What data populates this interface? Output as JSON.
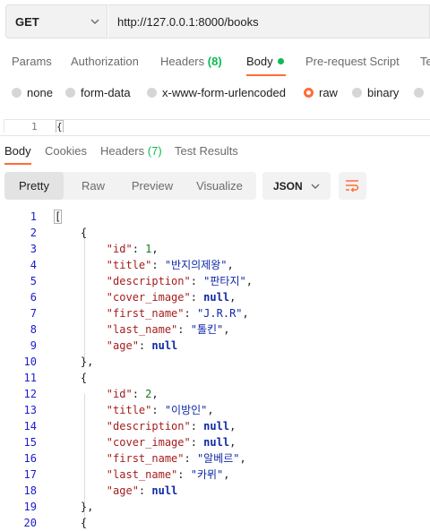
{
  "request": {
    "method": "GET",
    "url": "http://127.0.0.1:8000/books"
  },
  "request_tabs": [
    {
      "label": "Params"
    },
    {
      "label": "Authorization"
    },
    {
      "label": "Headers",
      "count": "(8)"
    },
    {
      "label": "Body"
    },
    {
      "label": "Pre-request Script"
    },
    {
      "label": "Te"
    }
  ],
  "body_types": [
    "none",
    "form-data",
    "x-www-form-urlencoded",
    "raw",
    "binary"
  ],
  "selected_body_type": "raw",
  "request_editor": {
    "line": "1",
    "text": "{"
  },
  "response_tabs": [
    {
      "label": "Body"
    },
    {
      "label": "Cookies"
    },
    {
      "label": "Headers",
      "count": "(7)"
    },
    {
      "label": "Test Results"
    }
  ],
  "view_modes": [
    "Pretty",
    "Raw",
    "Preview",
    "Visualize"
  ],
  "active_view": "Pretty",
  "format": "JSON",
  "colors": {
    "accent": "#ff6c37",
    "success": "#0cbb52"
  },
  "icons": {
    "method": "chevron-down-icon",
    "format": "chevron-down-icon",
    "wrap": "wrap-lines-icon"
  },
  "code_lines": [
    [
      {
        "t": "["
      }
    ],
    [
      {
        "t": "    {"
      }
    ],
    [
      {
        "t": "        "
      },
      {
        "t": "\"id\"",
        "c": "k"
      },
      {
        "t": ": "
      },
      {
        "t": "1",
        "c": "n"
      },
      {
        "t": ","
      }
    ],
    [
      {
        "t": "        "
      },
      {
        "t": "\"title\"",
        "c": "k"
      },
      {
        "t": ": "
      },
      {
        "t": "\"반지의제왕\"",
        "c": "s"
      },
      {
        "t": ","
      }
    ],
    [
      {
        "t": "        "
      },
      {
        "t": "\"description\"",
        "c": "k"
      },
      {
        "t": ": "
      },
      {
        "t": "\"판타지\"",
        "c": "s"
      },
      {
        "t": ","
      }
    ],
    [
      {
        "t": "        "
      },
      {
        "t": "\"cover_image\"",
        "c": "k"
      },
      {
        "t": ": "
      },
      {
        "t": "null",
        "c": "nl"
      },
      {
        "t": ","
      }
    ],
    [
      {
        "t": "        "
      },
      {
        "t": "\"first_name\"",
        "c": "k"
      },
      {
        "t": ": "
      },
      {
        "t": "\"J.R.R\"",
        "c": "s"
      },
      {
        "t": ","
      }
    ],
    [
      {
        "t": "        "
      },
      {
        "t": "\"last_name\"",
        "c": "k"
      },
      {
        "t": ": "
      },
      {
        "t": "\"톨킨\"",
        "c": "s"
      },
      {
        "t": ","
      }
    ],
    [
      {
        "t": "        "
      },
      {
        "t": "\"age\"",
        "c": "k"
      },
      {
        "t": ": "
      },
      {
        "t": "null",
        "c": "nl"
      }
    ],
    [
      {
        "t": "    },"
      }
    ],
    [
      {
        "t": "    {"
      }
    ],
    [
      {
        "t": "        "
      },
      {
        "t": "\"id\"",
        "c": "k"
      },
      {
        "t": ": "
      },
      {
        "t": "2",
        "c": "n"
      },
      {
        "t": ","
      }
    ],
    [
      {
        "t": "        "
      },
      {
        "t": "\"title\"",
        "c": "k"
      },
      {
        "t": ": "
      },
      {
        "t": "\"이방인\"",
        "c": "s"
      },
      {
        "t": ","
      }
    ],
    [
      {
        "t": "        "
      },
      {
        "t": "\"description\"",
        "c": "k"
      },
      {
        "t": ": "
      },
      {
        "t": "null",
        "c": "nl"
      },
      {
        "t": ","
      }
    ],
    [
      {
        "t": "        "
      },
      {
        "t": "\"cover_image\"",
        "c": "k"
      },
      {
        "t": ": "
      },
      {
        "t": "null",
        "c": "nl"
      },
      {
        "t": ","
      }
    ],
    [
      {
        "t": "        "
      },
      {
        "t": "\"first_name\"",
        "c": "k"
      },
      {
        "t": ": "
      },
      {
        "t": "\"알베르\"",
        "c": "s"
      },
      {
        "t": ","
      }
    ],
    [
      {
        "t": "        "
      },
      {
        "t": "\"last_name\"",
        "c": "k"
      },
      {
        "t": ": "
      },
      {
        "t": "\"카뮈\"",
        "c": "s"
      },
      {
        "t": ","
      }
    ],
    [
      {
        "t": "        "
      },
      {
        "t": "\"age\"",
        "c": "k"
      },
      {
        "t": ": "
      },
      {
        "t": "null",
        "c": "nl"
      }
    ],
    [
      {
        "t": "    },"
      }
    ],
    [
      {
        "t": "    {"
      }
    ]
  ]
}
